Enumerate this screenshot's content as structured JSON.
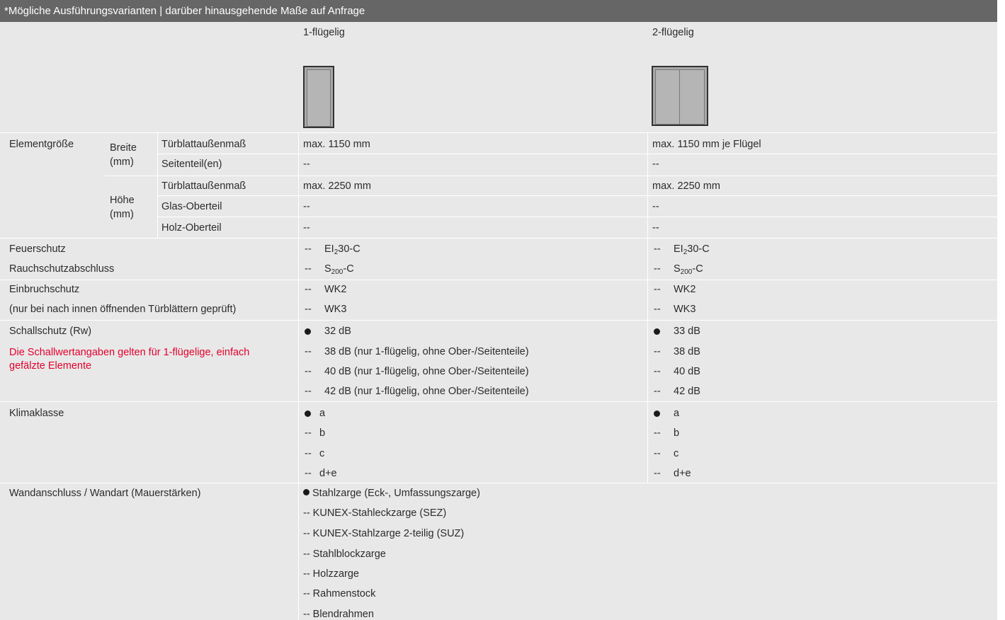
{
  "header": {
    "title": "*Mögliche Ausführungsvarianten | darüber hinausgehende Maße auf Anfrage"
  },
  "columns": {
    "col1": "1-flügelig",
    "col2": "2-flügelig"
  },
  "size": {
    "label": "Elementgröße",
    "breite": "Breite (mm)",
    "hoehe": "Höhe (mm)",
    "rows": [
      {
        "sub": "Türblattaußenmaß",
        "c1": "max. 1150 mm",
        "c2": "max. 1150 mm je Flügel"
      },
      {
        "sub": "Seitenteil(en)",
        "c1": "--",
        "c2": "--"
      },
      {
        "sub": "Türblattaußenmaß",
        "c1": "max. 2250 mm",
        "c2": "max. 2250 mm"
      },
      {
        "sub": "Glas-Oberteil",
        "c1": "--",
        "c2": "--"
      },
      {
        "sub": "Holz-Oberteil",
        "c1": "--",
        "c2": "--"
      }
    ]
  },
  "fire": {
    "label1": "Feuerschutz",
    "label2": "Rauchschutzabschluss",
    "marker": "--",
    "fire_value": "EI",
    "fire_sub": "2",
    "fire_tail": "30-C",
    "smoke_value": "S",
    "smoke_sub": "200",
    "smoke_tail": "-C"
  },
  "burglary": {
    "label1": "Einbruchschutz",
    "label2": "(nur bei nach innen öffnenden Türblättern geprüft)",
    "marker": "--",
    "v1": "WK2",
    "v2": "WK3"
  },
  "sound": {
    "label": "Schallschutz (Rw)",
    "note": "Die Schallwertangaben gelten für 1-flügelige, einfach gefälzte Elemente",
    "marker": "--",
    "c1": [
      "32 dB",
      "38 dB (nur 1-flügelig, ohne Ober-/Seitenteile)",
      "40 dB (nur 1-flügelig, ohne Ober-/Seitenteile)",
      "42 dB (nur 1-flügelig, ohne Ober-/Seitenteile)"
    ],
    "c2": [
      "33 dB",
      "38 dB",
      "40 dB",
      "42 dB"
    ]
  },
  "climate": {
    "label": "Klimaklasse",
    "marker": "--",
    "values": [
      "a",
      "b",
      "c",
      "d+e"
    ]
  },
  "wall": {
    "label": "Wandanschluss / Wandart (Mauerstärken)",
    "items": [
      "Stahlzarge (Eck-, Umfassungszarge)",
      "-- KUNEX-Stahleckzarge (SEZ)",
      "-- KUNEX-Stahlzarge 2-teilig  (SUZ)",
      "-- Stahlblockzarge",
      "-- Holzzarge",
      "-- Rahmenstock",
      "-- Blendrahmen"
    ]
  },
  "colors": {
    "header_bg": "#666666",
    "panel_bg": "#e8e8e8",
    "note_red": "#e2002d"
  }
}
